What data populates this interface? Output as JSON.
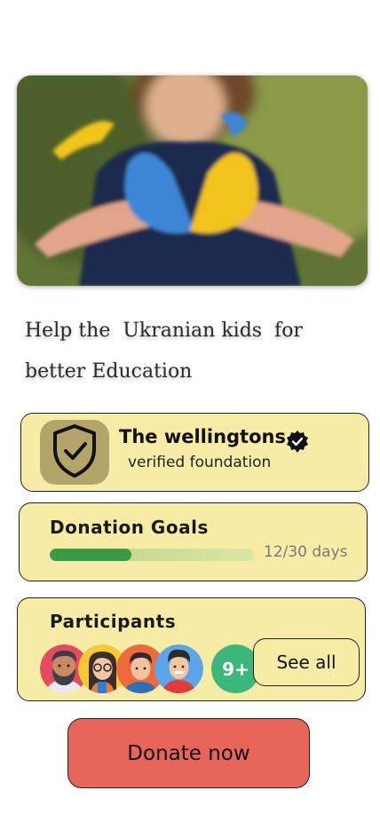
{
  "hero": {
    "image": "girl-heart-hands-photo"
  },
  "headline": "Help the  Ukranian kids  for better Education",
  "organization": {
    "name": "The  wellingtons",
    "subtitle": "verified foundation",
    "badge_icon": "shield-check-icon",
    "verified_icon": "verified-check-icon"
  },
  "donation_goals": {
    "title": "Donation  Goals",
    "progress_fraction": 0.4,
    "days_text": "12/30  days",
    "colors": {
      "fill": "#3e9a42",
      "track": "#c9dd98"
    }
  },
  "participants": {
    "title": "Participants",
    "avatars": [
      "bearded-man-avatar",
      "woman-glasses-avatar",
      "boy-avatar",
      "man-red-shirt-avatar"
    ],
    "more_count": "9+",
    "see_all_label": "See all"
  },
  "donate_button": {
    "label": "Donate now"
  },
  "colors": {
    "card_bg": "#f7eca6",
    "badge_bg": "#b3a46a",
    "donate_bg": "#e8655a",
    "more_badge": "#3cb77a"
  }
}
